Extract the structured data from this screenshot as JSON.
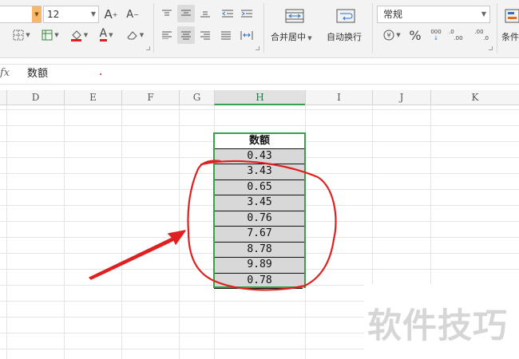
{
  "ribbon": {
    "font_size": "12",
    "alignment_row1": [
      "align-top-icon",
      "align-middle-icon",
      "align-bottom-icon",
      "indent-decrease-icon",
      "indent-increase-icon"
    ],
    "merge_label": "合并居中",
    "wrap_label": "自动换行",
    "number_format": "常规",
    "percent_symbol": "%",
    "thousands_label": "000",
    "decimal_increase_label": ".00",
    "decimal_decrease_label": ".0",
    "conditional_label": "条件"
  },
  "formula_bar": {
    "fx": "fx",
    "value": "数额"
  },
  "columns": [
    "D",
    "E",
    "F",
    "G",
    "H",
    "I",
    "J",
    "K"
  ],
  "selected_column": "H",
  "table": {
    "header": "数额",
    "values": [
      "0.43",
      "3.43",
      "0.65",
      "3.45",
      "0.76",
      "7.67",
      "8.78",
      "9.89",
      "0.78"
    ]
  },
  "watermark": "软件技巧",
  "colors": {
    "selection": "#3aa04a",
    "annotation": "#e02020",
    "cell_fill": "#d8d8d8"
  }
}
